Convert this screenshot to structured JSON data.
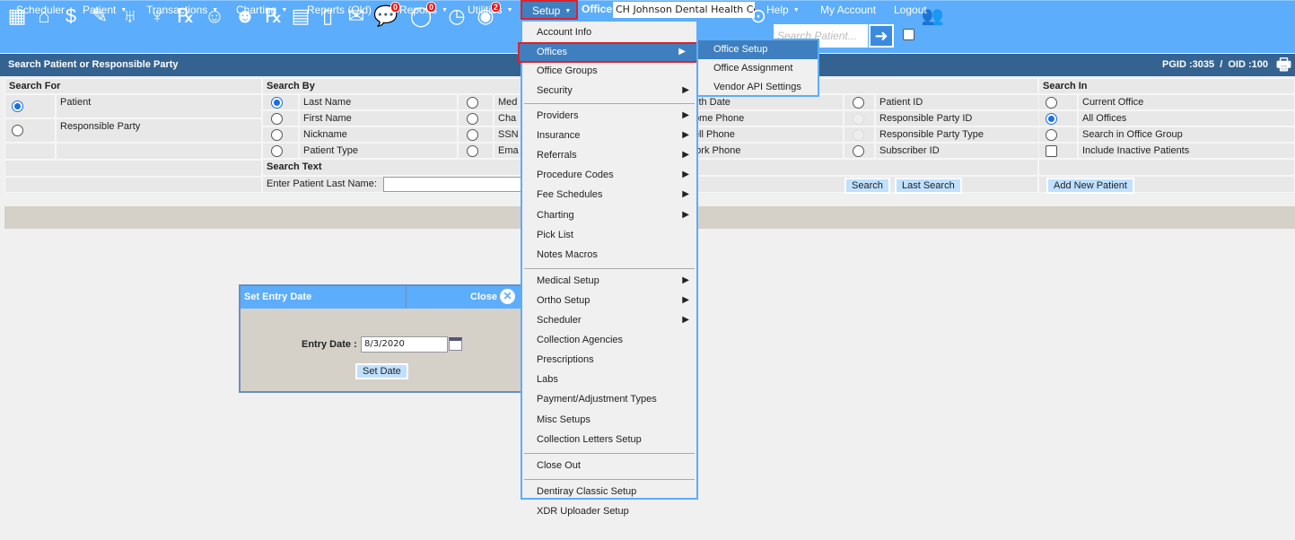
{
  "nav": {
    "items": [
      {
        "label": "Scheduler",
        "caret": false
      },
      {
        "label": "Patient",
        "caret": true
      },
      {
        "label": "Transactions",
        "caret": true
      },
      {
        "label": "Charting",
        "caret": true
      },
      {
        "label": "Reports (Old)",
        "caret": true
      },
      {
        "label": "Reports",
        "caret": true
      },
      {
        "label": "Utilities",
        "caret": true
      }
    ],
    "setup": "Setup",
    "office_label": "Office",
    "office_value": "CH Johnson Dental Health Ce",
    "right": [
      {
        "label": "Help",
        "caret": true
      },
      {
        "label": "My Account",
        "caret": false
      },
      {
        "label": "Logout",
        "caret": false
      }
    ]
  },
  "toolbar": {
    "icons": [
      "calendar-icon",
      "home-icon",
      "transfer-money-icon",
      "edit-list-icon",
      "tooth-icon",
      "tooth-root-icon",
      "treatment-icon",
      "add-user-icon",
      "add-family-icon",
      "prescription-icon",
      "notepad-icon",
      "print-doc-icon",
      "mail-icon",
      "chat-icon",
      "message-icon",
      "clock-icon",
      "global-users-icon"
    ],
    "chat_badge": "0",
    "message_badge": "0",
    "users_badge": "2",
    "search_placeholder": "Search Patient..."
  },
  "header": {
    "title": "Search Patient or Responsible Party",
    "ids": "PGID :3035  /  OID :100"
  },
  "search_for": {
    "heading": "Search For",
    "options": [
      {
        "label": "Patient",
        "checked": true
      },
      {
        "label": "Responsible Party",
        "checked": false
      }
    ]
  },
  "search_by": {
    "heading": "Search By",
    "col1": [
      {
        "label": "Last Name",
        "checked": true
      },
      {
        "label": "First Name"
      },
      {
        "label": "Nickname"
      },
      {
        "label": "Patient Type"
      }
    ],
    "col2": [
      {
        "label": "Med"
      },
      {
        "label": "Cha"
      },
      {
        "label": "SSN"
      },
      {
        "label": "Ema"
      }
    ],
    "col3": [
      {
        "label": "Birth Date"
      },
      {
        "label": "Home Phone"
      },
      {
        "label": "Cell Phone"
      },
      {
        "label": "Work Phone"
      }
    ],
    "col4": [
      {
        "label": "Patient ID"
      },
      {
        "label": "Responsible Party ID",
        "disabled": true
      },
      {
        "label": "Responsible Party Type",
        "disabled": true
      },
      {
        "label": "Subscriber ID"
      }
    ],
    "text_heading": "Search Text",
    "text_label": "Enter Patient Last Name:",
    "text_value": "",
    "search_btn": "Search",
    "last_search_btn": "Last Search"
  },
  "search_in": {
    "heading": "Search In",
    "options": [
      {
        "label": "Current Office",
        "checked": false
      },
      {
        "label": "All Offices",
        "checked": true
      },
      {
        "label": "Search in Office Group",
        "checked": false
      }
    ],
    "inactive": "Include Inactive Patients",
    "inactive_checked": false,
    "add_btn": "Add New Patient"
  },
  "dialog": {
    "title": "Set Entry Date",
    "close": "Close",
    "date_label": "Entry Date :",
    "date_value": "8/3/2020",
    "set_btn": "Set Date"
  },
  "setup_menu": [
    {
      "label": "Account Info"
    },
    {
      "label": "Offices",
      "sub": true,
      "selected": true
    },
    {
      "label": "Office Groups"
    },
    {
      "label": "Security",
      "sub": true
    },
    {
      "sep": true
    },
    {
      "label": "Providers",
      "sub": true
    },
    {
      "label": "Insurance",
      "sub": true
    },
    {
      "label": "Referrals",
      "sub": true
    },
    {
      "label": "Procedure Codes",
      "sub": true
    },
    {
      "label": "Fee Schedules",
      "sub": true
    },
    {
      "label": "Charting",
      "sub": true
    },
    {
      "label": "Pick List"
    },
    {
      "label": "Notes Macros"
    },
    {
      "sep": true
    },
    {
      "label": "Medical Setup",
      "sub": true
    },
    {
      "label": "Ortho Setup",
      "sub": true
    },
    {
      "label": "Scheduler",
      "sub": true
    },
    {
      "label": "Collection Agencies"
    },
    {
      "label": "Prescriptions"
    },
    {
      "label": "Labs"
    },
    {
      "label": "Payment/Adjustment Types"
    },
    {
      "label": "Misc Setups"
    },
    {
      "label": "Collection Letters Setup"
    },
    {
      "sep": true
    },
    {
      "label": "Close Out"
    },
    {
      "sep": true
    },
    {
      "label": "Dentiray Classic Setup"
    },
    {
      "label": "XDR Uploader Setup"
    }
  ],
  "offices_submenu": [
    {
      "label": "Office Setup",
      "selected": true
    },
    {
      "label": "Office Assignment"
    },
    {
      "label": "Vendor API Settings"
    }
  ],
  "colors": {
    "nav": "#5cadfb",
    "header": "#346392",
    "highlight": "#3f7fc0",
    "outline": "#e0202a"
  }
}
